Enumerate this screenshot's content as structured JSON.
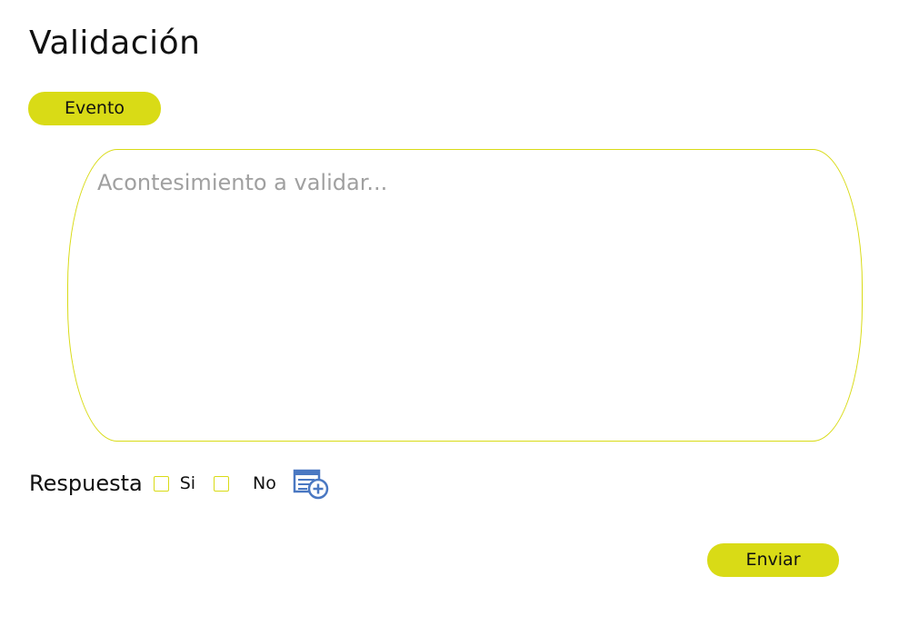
{
  "page": {
    "title": "Validación"
  },
  "event": {
    "label": "Evento"
  },
  "textarea": {
    "placeholder": "Acontesimiento a validar...",
    "value": ""
  },
  "answer": {
    "label": "Respuesta",
    "options": [
      {
        "label": "Si",
        "checked": false
      },
      {
        "label": "No",
        "checked": false
      }
    ]
  },
  "actions": {
    "add_icon": "add-form-icon",
    "send_label": "Enviar"
  },
  "colors": {
    "accent": "#d9db16",
    "icon_blue": "#4a78c2",
    "placeholder": "#a0a0a0"
  }
}
